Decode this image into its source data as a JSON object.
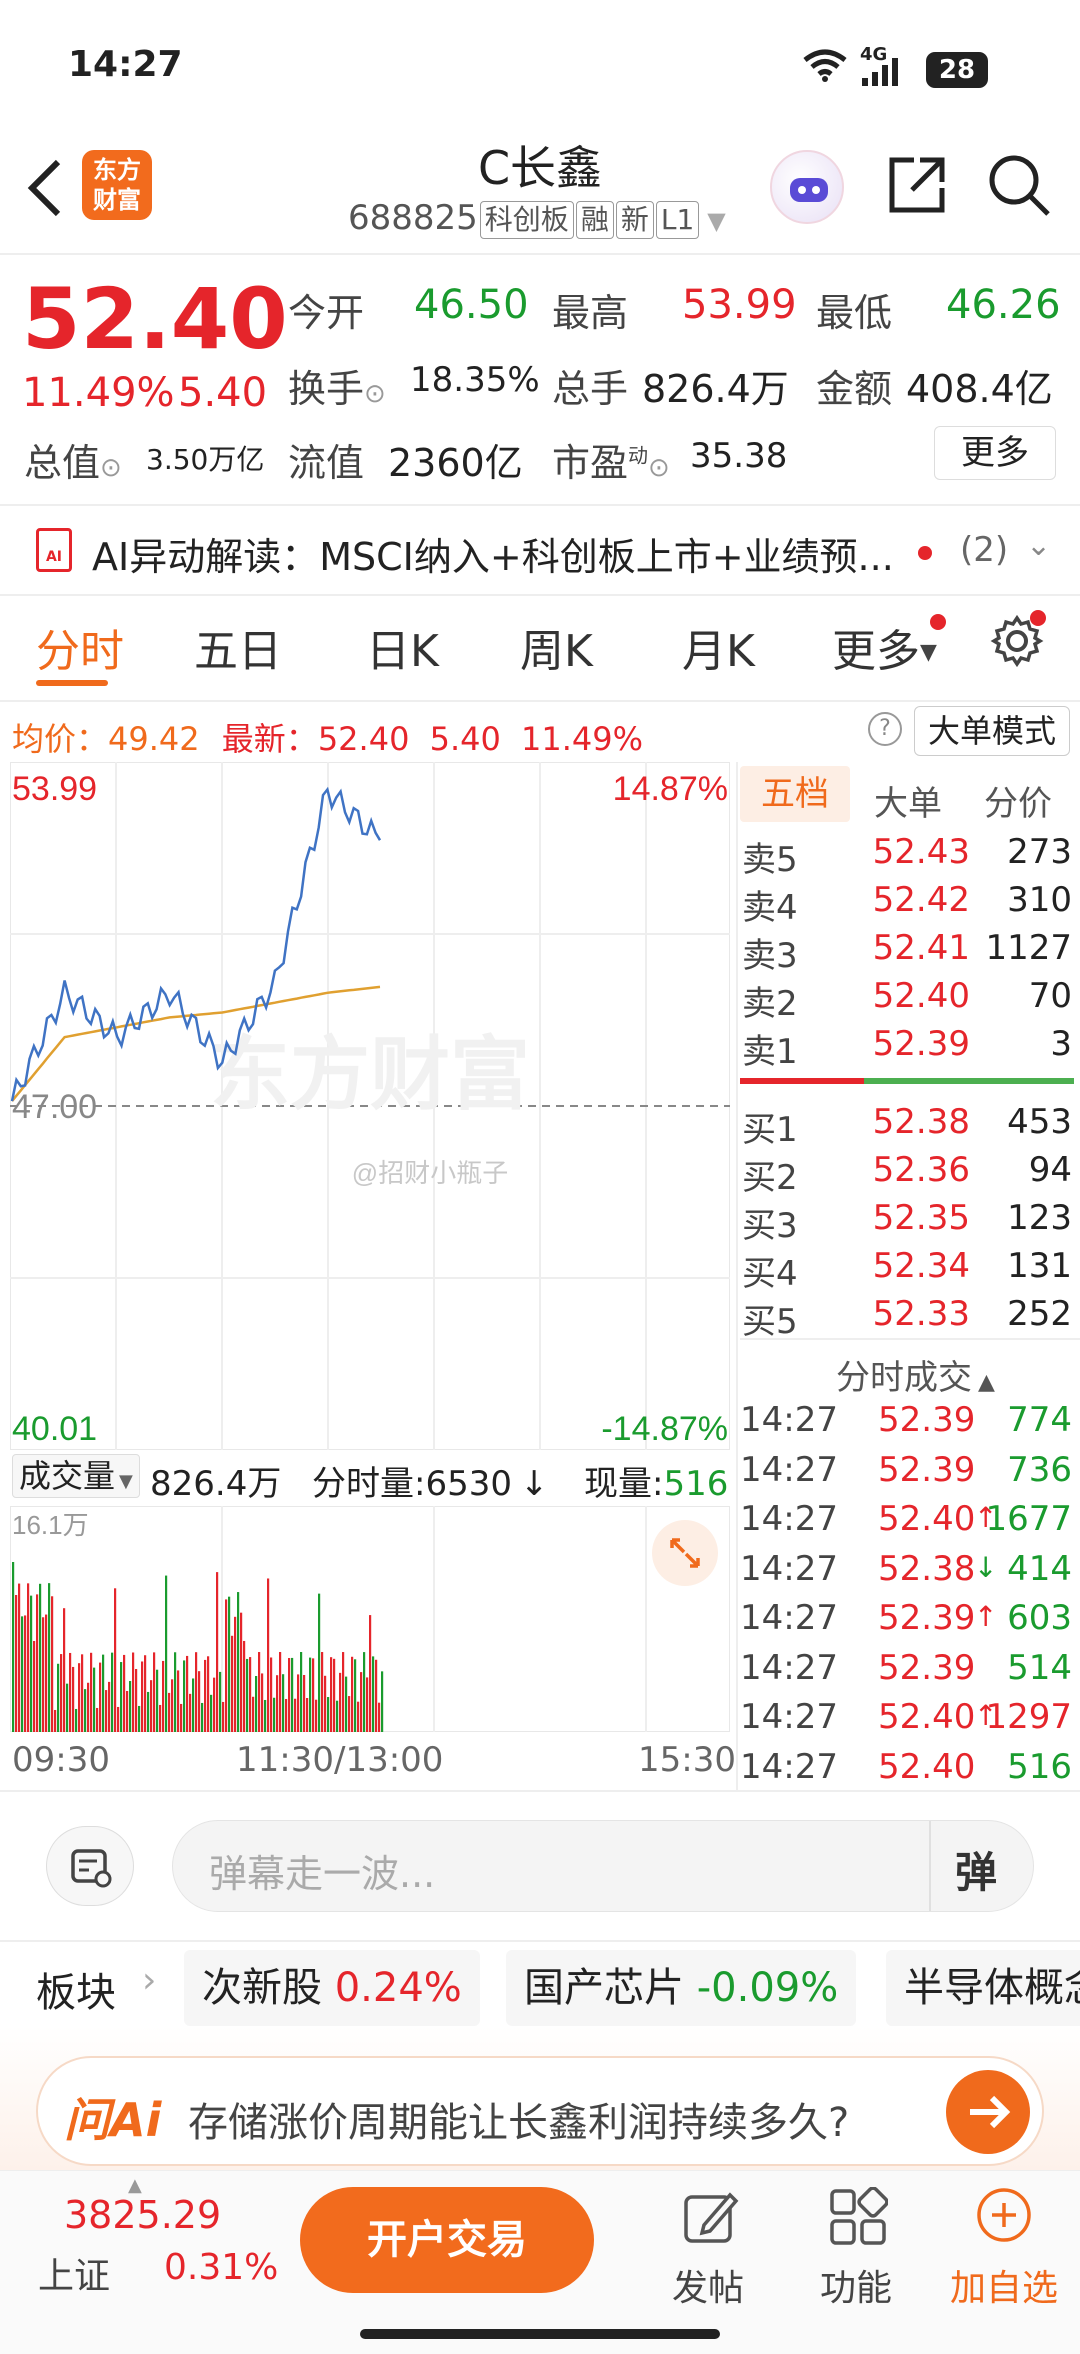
{
  "status_bar": {
    "time": "14:27",
    "network": "4G",
    "battery": "28"
  },
  "header": {
    "logo_line1": "东方",
    "logo_line2": "财富",
    "title": "C长鑫",
    "code": "688825",
    "tags": [
      "科创板",
      "融",
      "新",
      "L1"
    ]
  },
  "quote": {
    "price": "52.40",
    "pct": "11.49%",
    "change": "5.40",
    "open_label": "今开",
    "open": "46.50",
    "high_label": "最高",
    "high": "53.99",
    "low_label": "最低",
    "low": "46.26",
    "turnover_label": "换手",
    "turnover": "18.35%",
    "volume_label": "总手",
    "volume": "826.4万",
    "amount_label": "金额",
    "amount": "408.4亿",
    "mktcap_label": "总值",
    "mktcap": "3.50万亿",
    "float_label": "流值",
    "float": "2360亿",
    "pe_label": "市盈",
    "pe_sup": "动",
    "pe": "35.38",
    "more_btn": "更多"
  },
  "ai_banner": {
    "text": "AI异动解读：MSCI纳入+科创板上市+业绩预...",
    "count": "(2)"
  },
  "tabs": [
    "分时",
    "五日",
    "日K",
    "周K",
    "月K",
    "更多"
  ],
  "chart_info": {
    "avg_label": "均价：",
    "avg": "49.42",
    "latest_label": "最新：",
    "latest": "52.40",
    "chg": "5.40",
    "pct": "11.49%",
    "mode_btn": "大单模式",
    "help": "?"
  },
  "chart_labels": {
    "ymax": "53.99",
    "ymid": "47.00",
    "ymin": "40.01",
    "pmax": "14.87%",
    "pmin": "-14.87%",
    "watermark": "东方财富",
    "weibo": "@招财小瓶子"
  },
  "volume_info": {
    "label": "成交量",
    "total": "826.4万",
    "minute_label": "分时量:",
    "minute": "6530",
    "now_label": "现量:",
    "now": "516",
    "ymax": "16.1万"
  },
  "time_axis": [
    "09:30",
    "11:30/13:00",
    "15:30"
  ],
  "chart_data": {
    "type": "line",
    "ylim": [
      40.01,
      53.99
    ],
    "ref": 47.0,
    "x": [
      "09:30",
      "10:00",
      "10:30",
      "11:00",
      "11:30/13:00",
      "13:30",
      "14:00",
      "14:27"
    ],
    "series": [
      {
        "values": [
          47.1,
          49.3,
          48.4,
          49.3,
          47.9,
          49.5,
          53.4,
          52.4
        ]
      },
      {
        "values": [
          47.1,
          48.4,
          48.6,
          48.8,
          48.9,
          49.1,
          49.3,
          49.42
        ]
      }
    ]
  },
  "order_tabs": [
    "五档",
    "大单",
    "分价"
  ],
  "asks": [
    {
      "l": "卖5",
      "p": "52.43",
      "v": "273"
    },
    {
      "l": "卖4",
      "p": "52.42",
      "v": "310"
    },
    {
      "l": "卖3",
      "p": "52.41",
      "v": "1127"
    },
    {
      "l": "卖2",
      "p": "52.40",
      "v": "70"
    },
    {
      "l": "卖1",
      "p": "52.39",
      "v": "3"
    }
  ],
  "bids": [
    {
      "l": "买1",
      "p": "52.38",
      "v": "453"
    },
    {
      "l": "买2",
      "p": "52.36",
      "v": "94"
    },
    {
      "l": "买3",
      "p": "52.35",
      "v": "123"
    },
    {
      "l": "买4",
      "p": "52.34",
      "v": "131"
    },
    {
      "l": "买5",
      "p": "52.33",
      "v": "252"
    }
  ],
  "ticks_title": "分时成交",
  "ticks": [
    {
      "t": "14:27",
      "p": "52.39",
      "v": "774",
      "a": ""
    },
    {
      "t": "14:27",
      "p": "52.39",
      "v": "736",
      "a": ""
    },
    {
      "t": "14:27",
      "p": "52.40",
      "v": "1677",
      "a": "↑"
    },
    {
      "t": "14:27",
      "p": "52.38",
      "v": "414",
      "a": "↓"
    },
    {
      "t": "14:27",
      "p": "52.39",
      "v": "603",
      "a": "↑"
    },
    {
      "t": "14:27",
      "p": "52.39",
      "v": "514",
      "a": ""
    },
    {
      "t": "14:27",
      "p": "52.40",
      "v": "1297",
      "a": "↑"
    },
    {
      "t": "14:27",
      "p": "52.40",
      "v": "516",
      "a": ""
    }
  ],
  "danmu": {
    "placeholder": "弹幕走一波...",
    "btn": "弹"
  },
  "sectors": {
    "label": "板块",
    "items": [
      {
        "name": "次新股",
        "pct": "0.24%"
      },
      {
        "name": "国产芯片",
        "pct": "-0.09%"
      },
      {
        "name": "半导体概念",
        "pct": ""
      }
    ]
  },
  "ask_ai": {
    "logo": "问Ai",
    "text": "存储涨价周期能让长鑫利润持续多久?"
  },
  "bottom": {
    "index_value": "3825.29",
    "index_name": "上证",
    "index_pct": "0.31%",
    "trade_btn": "开户交易",
    "post": "发帖",
    "func": "功能",
    "watch": "加自选"
  }
}
